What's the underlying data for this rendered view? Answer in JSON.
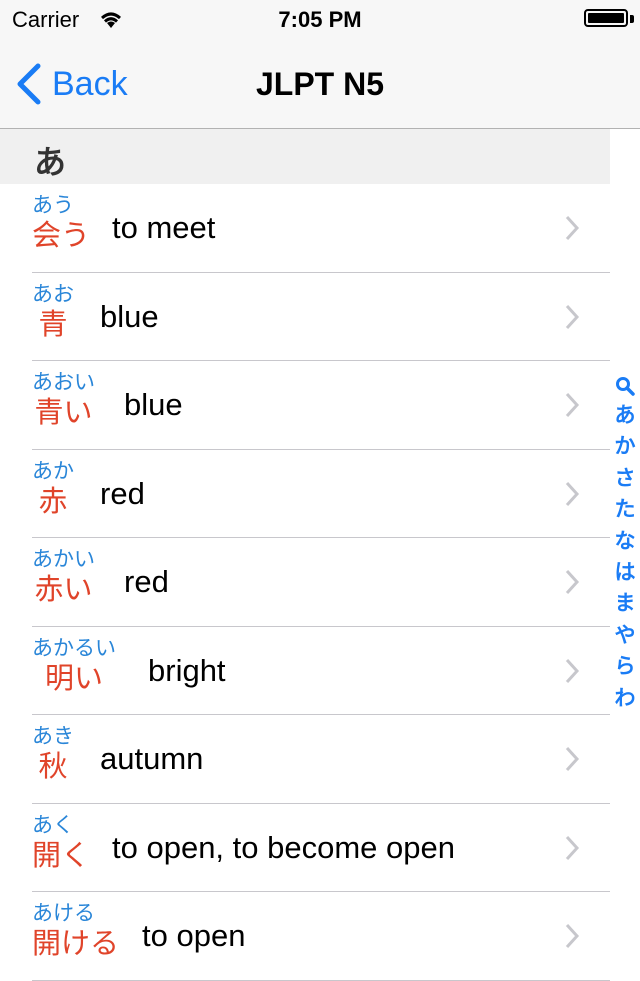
{
  "status_bar": {
    "carrier": "Carrier",
    "time": "7:05 PM"
  },
  "nav": {
    "back_label": "Back",
    "title": "JLPT N5"
  },
  "section": {
    "header": "あ"
  },
  "entries": [
    {
      "kana": "あう",
      "kanji": "会う",
      "meaning": "to meet"
    },
    {
      "kana": "あお",
      "kanji": "青",
      "meaning": "blue"
    },
    {
      "kana": "あおい",
      "kanji": "青い",
      "meaning": "blue"
    },
    {
      "kana": "あか",
      "kanji": "赤",
      "meaning": "red"
    },
    {
      "kana": "あかい",
      "kanji": "赤い",
      "meaning": "red"
    },
    {
      "kana": "あかるい",
      "kanji": "明い",
      "meaning": "bright"
    },
    {
      "kana": "あき",
      "kanji": "秋",
      "meaning": "autumn"
    },
    {
      "kana": "あく",
      "kanji": "開く",
      "meaning": "to open, to become open"
    },
    {
      "kana": "あける",
      "kanji": "開ける",
      "meaning": "to open"
    }
  ],
  "index_bar": {
    "icon": "search-icon",
    "items": [
      "あ",
      "か",
      "さ",
      "た",
      "な",
      "は",
      "ま",
      "や",
      "ら",
      "わ"
    ]
  },
  "colors": {
    "accent": "#1a7cf5",
    "kana": "#2a86d8",
    "kanji": "#e0442a"
  }
}
